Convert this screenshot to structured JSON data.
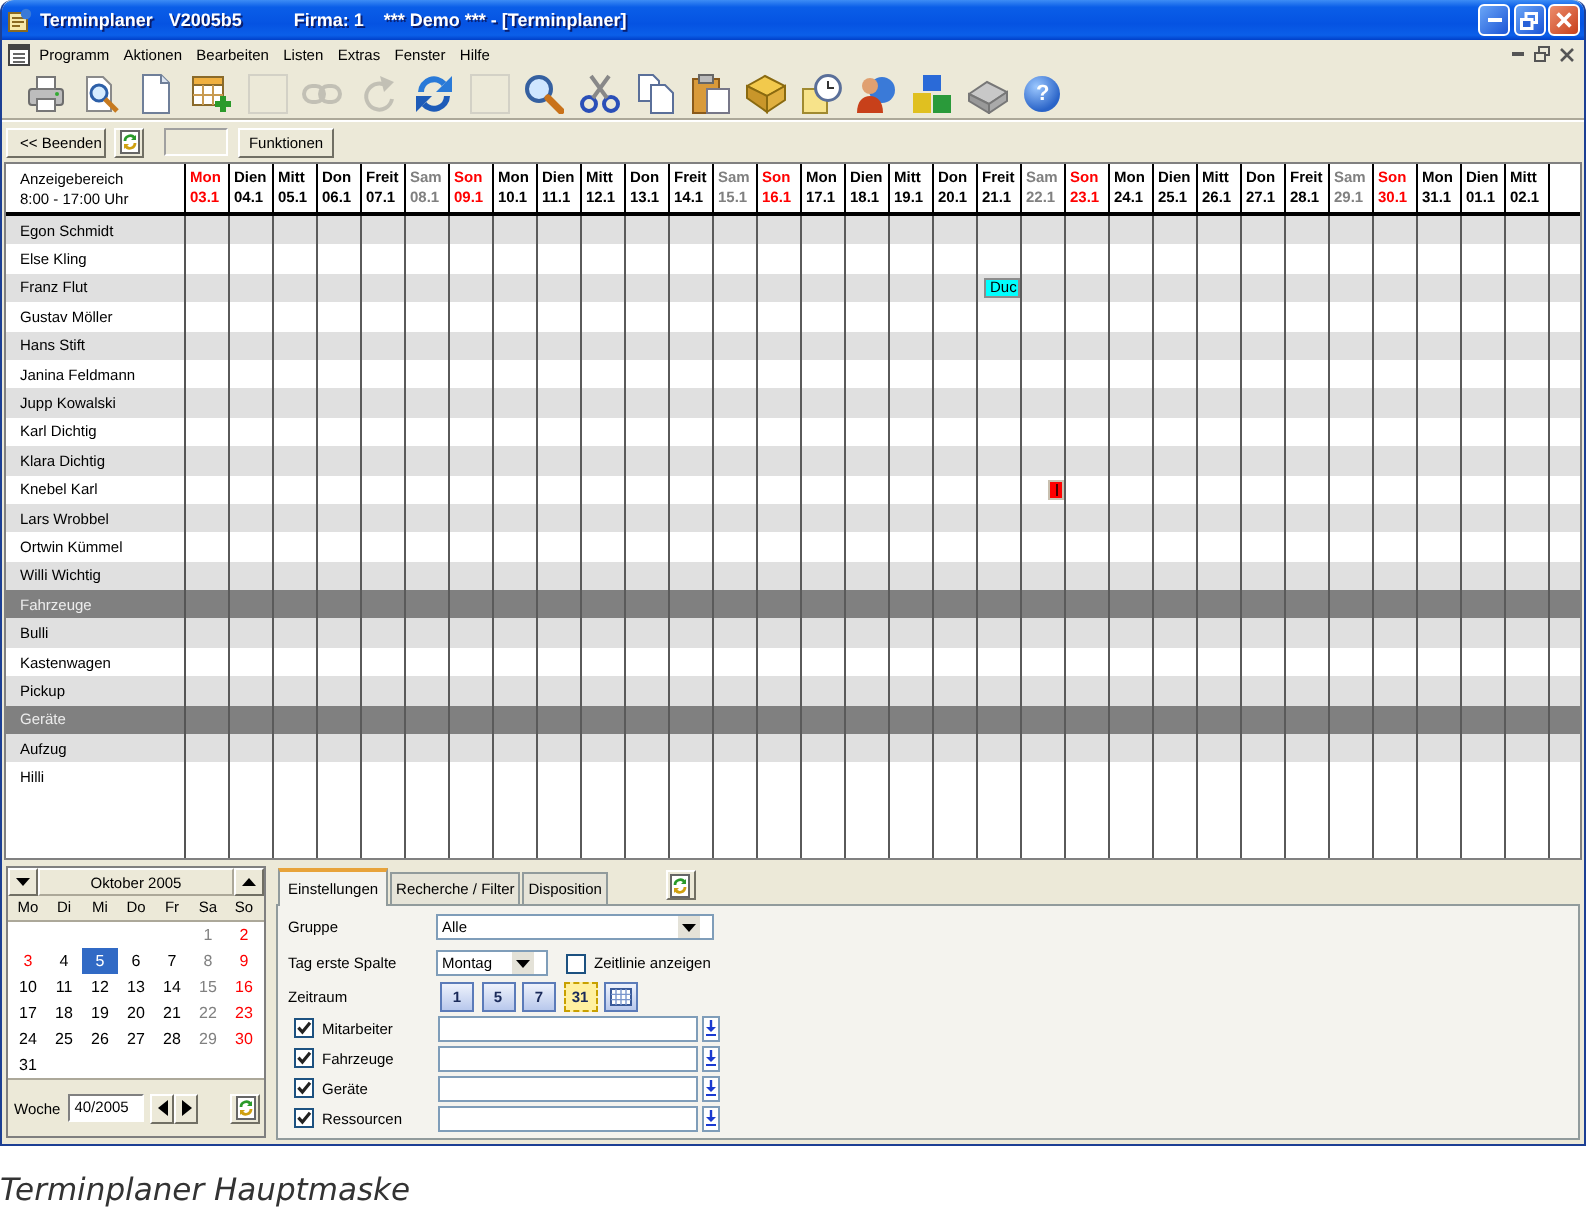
{
  "window": {
    "title_parts": [
      "Terminplaner",
      "V2005b5",
      "Firma: 1",
      "*** Demo *** - [Terminplaner]"
    ]
  },
  "menu": [
    "Programm",
    "Aktionen",
    "Bearbeiten",
    "Listen",
    "Extras",
    "Fenster",
    "Hilfe"
  ],
  "toolbar": [
    {
      "disabled": false
    },
    {
      "disabled": false
    },
    {
      "disabled": false
    },
    {
      "disabled": false
    },
    {
      "disabled": true
    },
    {
      "disabled": true
    },
    {
      "disabled": true
    },
    {
      "disabled": false
    },
    {
      "disabled": true
    },
    {
      "disabled": false
    },
    {
      "disabled": false
    },
    {
      "disabled": false
    },
    {
      "disabled": false
    },
    {
      "disabled": false
    },
    {
      "disabled": false
    },
    {
      "disabled": false
    },
    {
      "disabled": false
    },
    {
      "disabled": false
    },
    {
      "disabled": false,
      "glyph": "?"
    }
  ],
  "action_bar": {
    "exit_button": "<< Beenden",
    "functions_button": "Funktionen"
  },
  "grid": {
    "range_label": "Anzeigebereich",
    "range_hours": "8:00 - 17:00 Uhr",
    "days": [
      {
        "name": "Mon",
        "date": "03.1",
        "color": "#ff0000"
      },
      {
        "name": "Dien",
        "date": "04.1",
        "color": "#000000"
      },
      {
        "name": "Mitt",
        "date": "05.1",
        "color": "#000000"
      },
      {
        "name": "Don",
        "date": "06.1",
        "color": "#000000"
      },
      {
        "name": "Freit",
        "date": "07.1",
        "color": "#000000"
      },
      {
        "name": "Sam",
        "date": "08.1",
        "color": "#808080"
      },
      {
        "name": "Son",
        "date": "09.1",
        "color": "#ff0000"
      },
      {
        "name": "Mon",
        "date": "10.1",
        "color": "#000000"
      },
      {
        "name": "Dien",
        "date": "11.1",
        "color": "#000000"
      },
      {
        "name": "Mitt",
        "date": "12.1",
        "color": "#000000"
      },
      {
        "name": "Don",
        "date": "13.1",
        "color": "#000000"
      },
      {
        "name": "Freit",
        "date": "14.1",
        "color": "#000000"
      },
      {
        "name": "Sam",
        "date": "15.1",
        "color": "#808080"
      },
      {
        "name": "Son",
        "date": "16.1",
        "color": "#ff0000"
      },
      {
        "name": "Mon",
        "date": "17.1",
        "color": "#000000"
      },
      {
        "name": "Dien",
        "date": "18.1",
        "color": "#000000"
      },
      {
        "name": "Mitt",
        "date": "19.1",
        "color": "#000000"
      },
      {
        "name": "Don",
        "date": "20.1",
        "color": "#000000"
      },
      {
        "name": "Freit",
        "date": "21.1",
        "color": "#000000"
      },
      {
        "name": "Sam",
        "date": "22.1",
        "color": "#808080"
      },
      {
        "name": "Son",
        "date": "23.1",
        "color": "#ff0000"
      },
      {
        "name": "Mon",
        "date": "24.1",
        "color": "#000000"
      },
      {
        "name": "Dien",
        "date": "25.1",
        "color": "#000000"
      },
      {
        "name": "Mitt",
        "date": "26.1",
        "color": "#000000"
      },
      {
        "name": "Don",
        "date": "27.1",
        "color": "#000000"
      },
      {
        "name": "Freit",
        "date": "28.1",
        "color": "#000000"
      },
      {
        "name": "Sam",
        "date": "29.1",
        "color": "#808080"
      },
      {
        "name": "Son",
        "date": "30.1",
        "color": "#ff0000"
      },
      {
        "name": "Mon",
        "date": "31.1",
        "color": "#000000"
      },
      {
        "name": "Dien",
        "date": "01.1",
        "color": "#000000"
      },
      {
        "name": "Mitt",
        "date": "02.1",
        "color": "#000000"
      }
    ],
    "rows": [
      {
        "kind": "resource",
        "name": "Egon Schmidt"
      },
      {
        "kind": "resource",
        "name": "Else Kling"
      },
      {
        "kind": "resource",
        "name": "Franz Flut",
        "cells": [
          null,
          null,
          null,
          null,
          null,
          null,
          null,
          null,
          null,
          null,
          null,
          null,
          null,
          null,
          null,
          null,
          null,
          null,
          {
            "kind": "bar",
            "label": "Duc",
            "color": "#00ffff"
          },
          null,
          null,
          null,
          null,
          null,
          null,
          null,
          null,
          null,
          null,
          null,
          null
        ]
      },
      {
        "kind": "resource",
        "name": "Gustav Möller"
      },
      {
        "kind": "resource",
        "name": "Hans Stift"
      },
      {
        "kind": "resource",
        "name": "Janina Feldmann"
      },
      {
        "kind": "resource",
        "name": "Jupp Kowalski"
      },
      {
        "kind": "resource",
        "name": "Karl Dichtig"
      },
      {
        "kind": "resource",
        "name": "Klara Dichtig"
      },
      {
        "kind": "resource",
        "name": "Knebel Karl",
        "cells": [
          null,
          null,
          null,
          null,
          null,
          null,
          null,
          null,
          null,
          null,
          null,
          null,
          null,
          null,
          null,
          null,
          null,
          null,
          null,
          {
            "kind": "mark",
            "color": "#ff0000"
          },
          null,
          null,
          null,
          null,
          null,
          null,
          null,
          null,
          null,
          null,
          null
        ]
      },
      {
        "kind": "resource",
        "name": "Lars Wrobbel"
      },
      {
        "kind": "resource",
        "name": "Ortwin Kümmel"
      },
      {
        "kind": "resource",
        "name": "Willi Wichtig"
      },
      {
        "kind": "group",
        "name": "Fahrzeuge"
      },
      {
        "kind": "resource",
        "name": "Bulli"
      },
      {
        "kind": "resource",
        "name": "Kastenwagen"
      },
      {
        "kind": "resource",
        "name": "Pickup"
      },
      {
        "kind": "group",
        "name": "Geräte"
      },
      {
        "kind": "resource",
        "name": "Aufzug"
      },
      {
        "kind": "resource",
        "name": "Hilli"
      }
    ]
  },
  "calendar": {
    "month": "Oktober 2005",
    "weekdays": [
      "Mo",
      "Di",
      "Mi",
      "Do",
      "Fr",
      "Sa",
      "So"
    ],
    "weeks": [
      [
        {
          "day": "1",
          "color": "#808080",
          "selected": false
        },
        {
          "day": "2",
          "color": "#ff0000",
          "selected": false
        }
      ],
      [
        {
          "day": "3",
          "color": "#ff0000",
          "selected": false
        },
        {
          "day": "4",
          "color": "#000000",
          "selected": false
        },
        {
          "day": "5",
          "selected": true
        },
        {
          "day": "6",
          "color": "#000000",
          "selected": false
        },
        {
          "day": "7",
          "color": "#000000",
          "selected": false
        },
        {
          "day": "8",
          "color": "#808080",
          "selected": false
        },
        {
          "day": "9",
          "color": "#ff0000",
          "selected": false
        }
      ],
      [
        {
          "day": "10",
          "color": "#000000",
          "selected": false
        },
        {
          "day": "11",
          "color": "#000000",
          "selected": false
        },
        {
          "day": "12",
          "color": "#000000",
          "selected": false
        },
        {
          "day": "13",
          "color": "#000000",
          "selected": false
        },
        {
          "day": "14",
          "color": "#000000",
          "selected": false
        },
        {
          "day": "15",
          "color": "#808080",
          "selected": false
        },
        {
          "day": "16",
          "color": "#ff0000",
          "selected": false
        }
      ],
      [
        {
          "day": "17",
          "color": "#000000",
          "selected": false
        },
        {
          "day": "18",
          "color": "#000000",
          "selected": false
        },
        {
          "day": "19",
          "color": "#000000",
          "selected": false
        },
        {
          "day": "20",
          "color": "#000000",
          "selected": false
        },
        {
          "day": "21",
          "color": "#000000",
          "selected": false
        },
        {
          "day": "22",
          "color": "#808080",
          "selected": false
        },
        {
          "day": "23",
          "color": "#ff0000",
          "selected": false
        }
      ],
      [
        {
          "day": "24",
          "color": "#000000",
          "selected": false
        },
        {
          "day": "25",
          "color": "#000000",
          "selected": false
        },
        {
          "day": "26",
          "color": "#000000",
          "selected": false
        },
        {
          "day": "27",
          "color": "#000000",
          "selected": false
        },
        {
          "day": "28",
          "color": "#000000",
          "selected": false
        },
        {
          "day": "29",
          "color": "#808080",
          "selected": false
        },
        {
          "day": "30",
          "color": "#ff0000",
          "selected": false
        }
      ],
      [
        {
          "day": "31",
          "color": "#000000",
          "selected": false
        }
      ]
    ],
    "week_label": "Woche",
    "week_value": "40/2005"
  },
  "settings": {
    "tabs": [
      {
        "label": "Einstellungen",
        "selected": true
      },
      {
        "label": "Recherche / Filter",
        "selected": false
      },
      {
        "label": "Disposition",
        "selected": false
      }
    ],
    "group": {
      "label": "Gruppe",
      "value": "Alle"
    },
    "first_day": {
      "label": "Tag erste Spalte",
      "value": "Montag"
    },
    "timeline": {
      "label": "Zeitlinie anzeigen",
      "checked": false
    },
    "period": {
      "label": "Zeitraum",
      "buttons": [
        {
          "kind": "number",
          "text": "1",
          "selected": false
        },
        {
          "kind": "number",
          "text": "5",
          "selected": false
        },
        {
          "kind": "number",
          "text": "7",
          "selected": false
        },
        {
          "kind": "number",
          "text": "31",
          "selected": true
        },
        {
          "kind": "grid",
          "selected": false
        }
      ]
    },
    "filters": [
      {
        "label": "Mitarbeiter",
        "checked": true
      },
      {
        "label": "Fahrzeuge",
        "checked": true
      },
      {
        "label": "Geräte",
        "checked": true
      },
      {
        "label": "Ressourcen",
        "checked": true
      }
    ]
  },
  "caption": "Terminplaner Hauptmaske"
}
